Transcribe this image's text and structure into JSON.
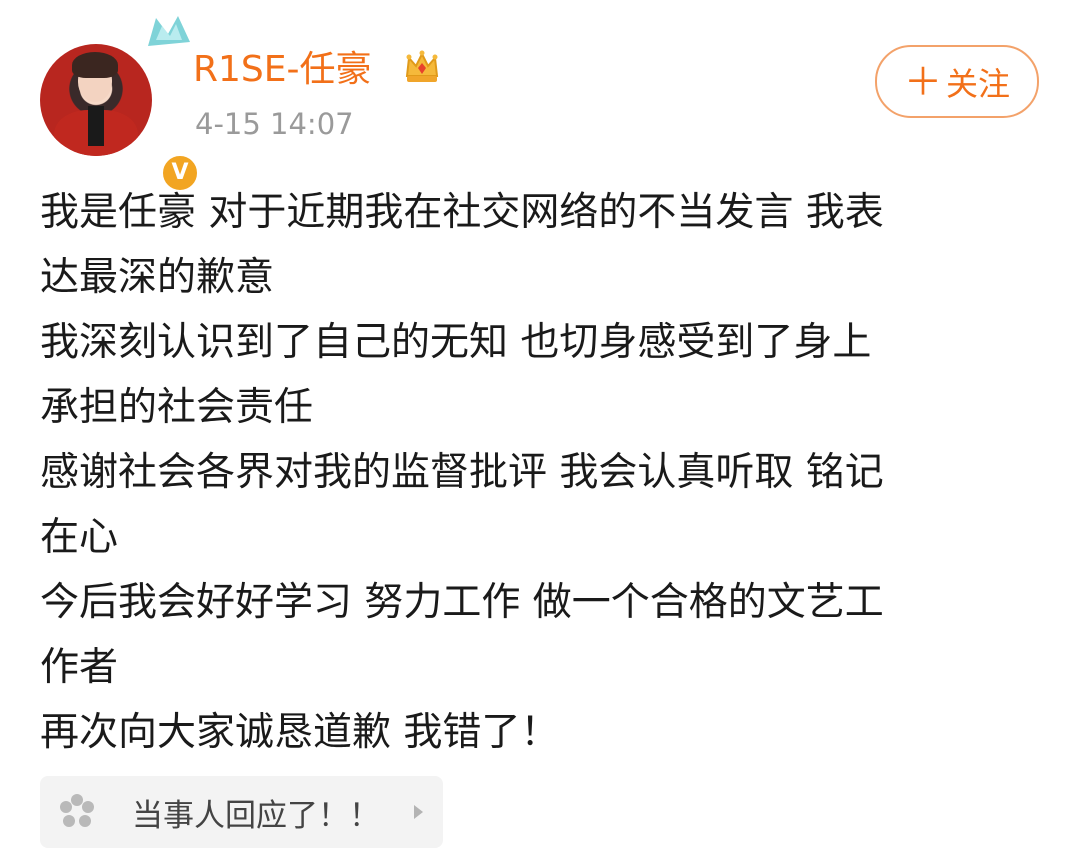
{
  "user": {
    "name": "R1SE-任豪",
    "timestamp": "4-15 14:07",
    "verified_badge": "V"
  },
  "follow_button": {
    "label": "关注",
    "icon": "plus-icon"
  },
  "post": {
    "lines": [
      "我是任豪 对于近期我在社交网络的不当发言 我表",
      "达最深的歉意",
      "我深刻认识到了自己的无知 也切身感受到了身上",
      "承担的社会责任",
      "感谢社会各界对我的监督批评 我会认真听取 铭记",
      "在心",
      "今后我会好好学习 努力工作 做一个合格的文艺工",
      "作者",
      "再次向大家诚恳道歉 我错了！"
    ]
  },
  "topic_chip": {
    "label": "当事人回应了！！",
    "icon": "flower-icon"
  },
  "colors": {
    "accent": "#f27019",
    "follow_border": "#f3a26a",
    "badge": "#f2a522",
    "text": "#1a1a1a",
    "muted": "#9a9a9a"
  }
}
